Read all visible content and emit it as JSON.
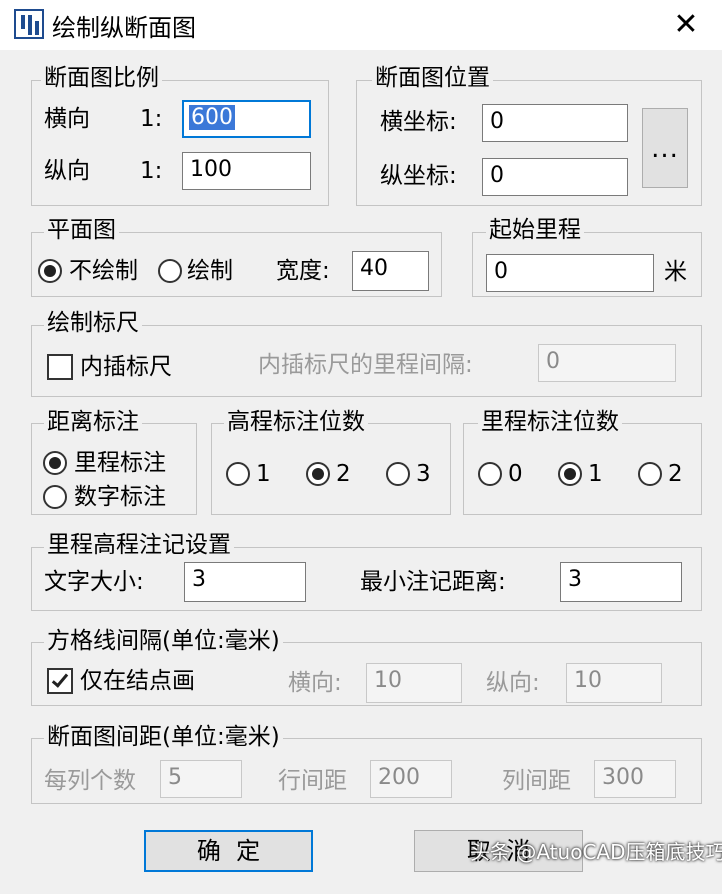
{
  "window": {
    "title": "绘制纵断面图",
    "close_glyph": "✕"
  },
  "scale": {
    "legend": "断面图比例",
    "horizontal_label": "横向",
    "horizontal_prefix": "1:",
    "horizontal_value": "600",
    "vertical_label": "纵向",
    "vertical_prefix": "1:",
    "vertical_value": "100"
  },
  "position": {
    "legend": "断面图位置",
    "x_label": "横坐标:",
    "x_value": "0",
    "y_label": "纵坐标:",
    "y_value": "0",
    "pick_label": "..."
  },
  "plan": {
    "legend": "平面图",
    "no_draw_label": "不绘制",
    "draw_label": "绘制",
    "selected": "不绘制",
    "width_label": "宽度:",
    "width_value": "40"
  },
  "start_mileage": {
    "legend": "起始里程",
    "value": "0",
    "unit": "米"
  },
  "ruler": {
    "legend": "绘制标尺",
    "interp_label": "内插标尺",
    "interp_checked": false,
    "interval_label": "内插标尺的里程间隔:",
    "interval_value": "0"
  },
  "distance_annot": {
    "legend": "距离标注",
    "options": [
      "里程标注",
      "数字标注"
    ],
    "selected": "里程标注"
  },
  "elev_digits": {
    "legend": "高程标注位数",
    "options": [
      "1",
      "2",
      "3"
    ],
    "selected": "2"
  },
  "mileage_digits": {
    "legend": "里程标注位数",
    "options": [
      "0",
      "1",
      "2"
    ],
    "selected": "1"
  },
  "annotation": {
    "legend": "里程高程注记设置",
    "text_size_label": "文字大小:",
    "text_size_value": "3",
    "min_dist_label": "最小注记距离:",
    "min_dist_value": "3"
  },
  "grid": {
    "legend": "方格线间隔(单位:毫米)",
    "nodes_only_label": "仅在结点画",
    "nodes_only_checked": true,
    "horizontal_label": "横向:",
    "horizontal_value": "10",
    "vertical_label": "纵向:",
    "vertical_value": "10"
  },
  "spacing": {
    "legend": "断面图间距(单位:毫米)",
    "per_col_label": "每列个数",
    "per_col_value": "5",
    "row_label": "行间距",
    "row_value": "200",
    "col_label": "列间距",
    "col_value": "300"
  },
  "buttons": {
    "ok": "确  定",
    "cancel": "取  消"
  },
  "watermark": "头条 @AtuoCAD压箱底技巧"
}
